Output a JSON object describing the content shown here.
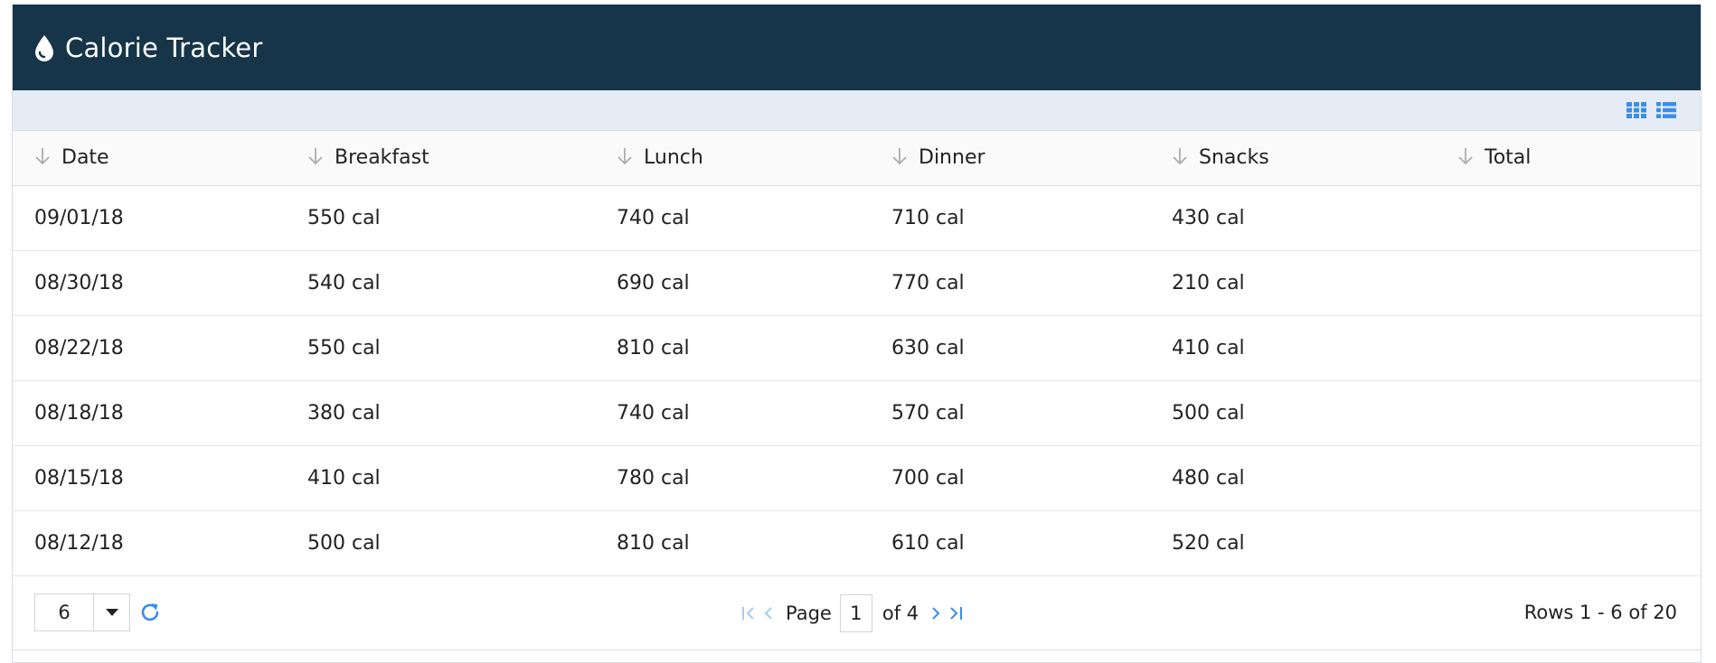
{
  "app": {
    "title": "Calorie Tracker",
    "icon": "drop-icon",
    "colors": {
      "header_bg": "#163549",
      "toolbar_bg": "#e6ecf5",
      "accent": "#3a8ee6"
    }
  },
  "toolbar": {
    "views": [
      {
        "name": "grid-view",
        "icon": "grid-icon"
      },
      {
        "name": "list-view",
        "icon": "list-icon"
      }
    ]
  },
  "table": {
    "columns": [
      "Date",
      "Breakfast",
      "Lunch",
      "Dinner",
      "Snacks",
      "Total"
    ],
    "rows": [
      {
        "date": "09/01/18",
        "breakfast": "550 cal",
        "lunch": "740 cal",
        "dinner": "710 cal",
        "snacks": "430 cal",
        "total": ""
      },
      {
        "date": "08/30/18",
        "breakfast": "540 cal",
        "lunch": "690 cal",
        "dinner": "770 cal",
        "snacks": "210 cal",
        "total": ""
      },
      {
        "date": "08/22/18",
        "breakfast": "550 cal",
        "lunch": "810 cal",
        "dinner": "630 cal",
        "snacks": "410 cal",
        "total": ""
      },
      {
        "date": "08/18/18",
        "breakfast": "380 cal",
        "lunch": "740 cal",
        "dinner": "570 cal",
        "snacks": "500 cal",
        "total": ""
      },
      {
        "date": "08/15/18",
        "breakfast": "410 cal",
        "lunch": "780 cal",
        "dinner": "700 cal",
        "snacks": "480 cal",
        "total": ""
      },
      {
        "date": "08/12/18",
        "breakfast": "500 cal",
        "lunch": "810 cal",
        "dinner": "610 cal",
        "snacks": "520 cal",
        "total": ""
      }
    ]
  },
  "footer": {
    "page_size": "6",
    "page_label": "Page",
    "current_page": "1",
    "of_label": "of 4",
    "rows_info": "Rows 1 - 6 of 20"
  }
}
